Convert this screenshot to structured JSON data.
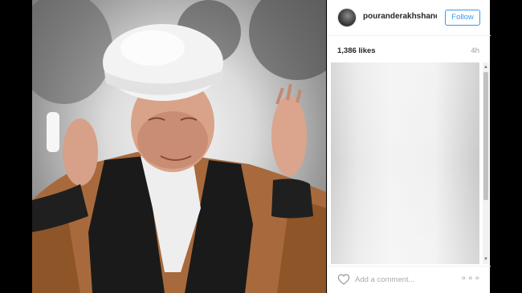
{
  "post": {
    "username": "pouranderakhshand...",
    "follow_label": "Follow",
    "likes": "1,386 likes",
    "time": "4h",
    "comment_placeholder": "Add a comment...",
    "more_label": "∘∘∘"
  },
  "scrollbar": {
    "up_arrow": "▲",
    "down_arrow": "▼"
  },
  "icons": {
    "heart": "heart-icon",
    "more": "more-options-icon",
    "avatar": "profile-avatar"
  },
  "colors": {
    "follow_blue": "#3897f0",
    "text_dark": "#262626",
    "text_muted": "#999999"
  }
}
